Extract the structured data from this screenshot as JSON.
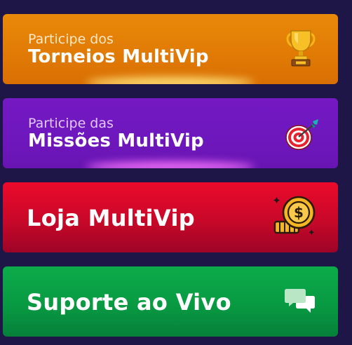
{
  "menu": {
    "tournaments": {
      "line1": "Participe dos",
      "line2": "Torneios MultiVip",
      "icon": "trophy-icon"
    },
    "missions": {
      "line1": "Participe das",
      "line2": "Missões MultiVip",
      "icon": "target-icon"
    },
    "store": {
      "label": "Loja MultiVip",
      "icon": "coin-icon"
    },
    "support": {
      "label": "Suporte ao Vivo",
      "icon": "chat-icon"
    }
  },
  "colors": {
    "background": "#1d1647",
    "tournaments": "#e17b05",
    "missions": "#6e17bd",
    "store": "#c80829",
    "support": "#089a42"
  }
}
